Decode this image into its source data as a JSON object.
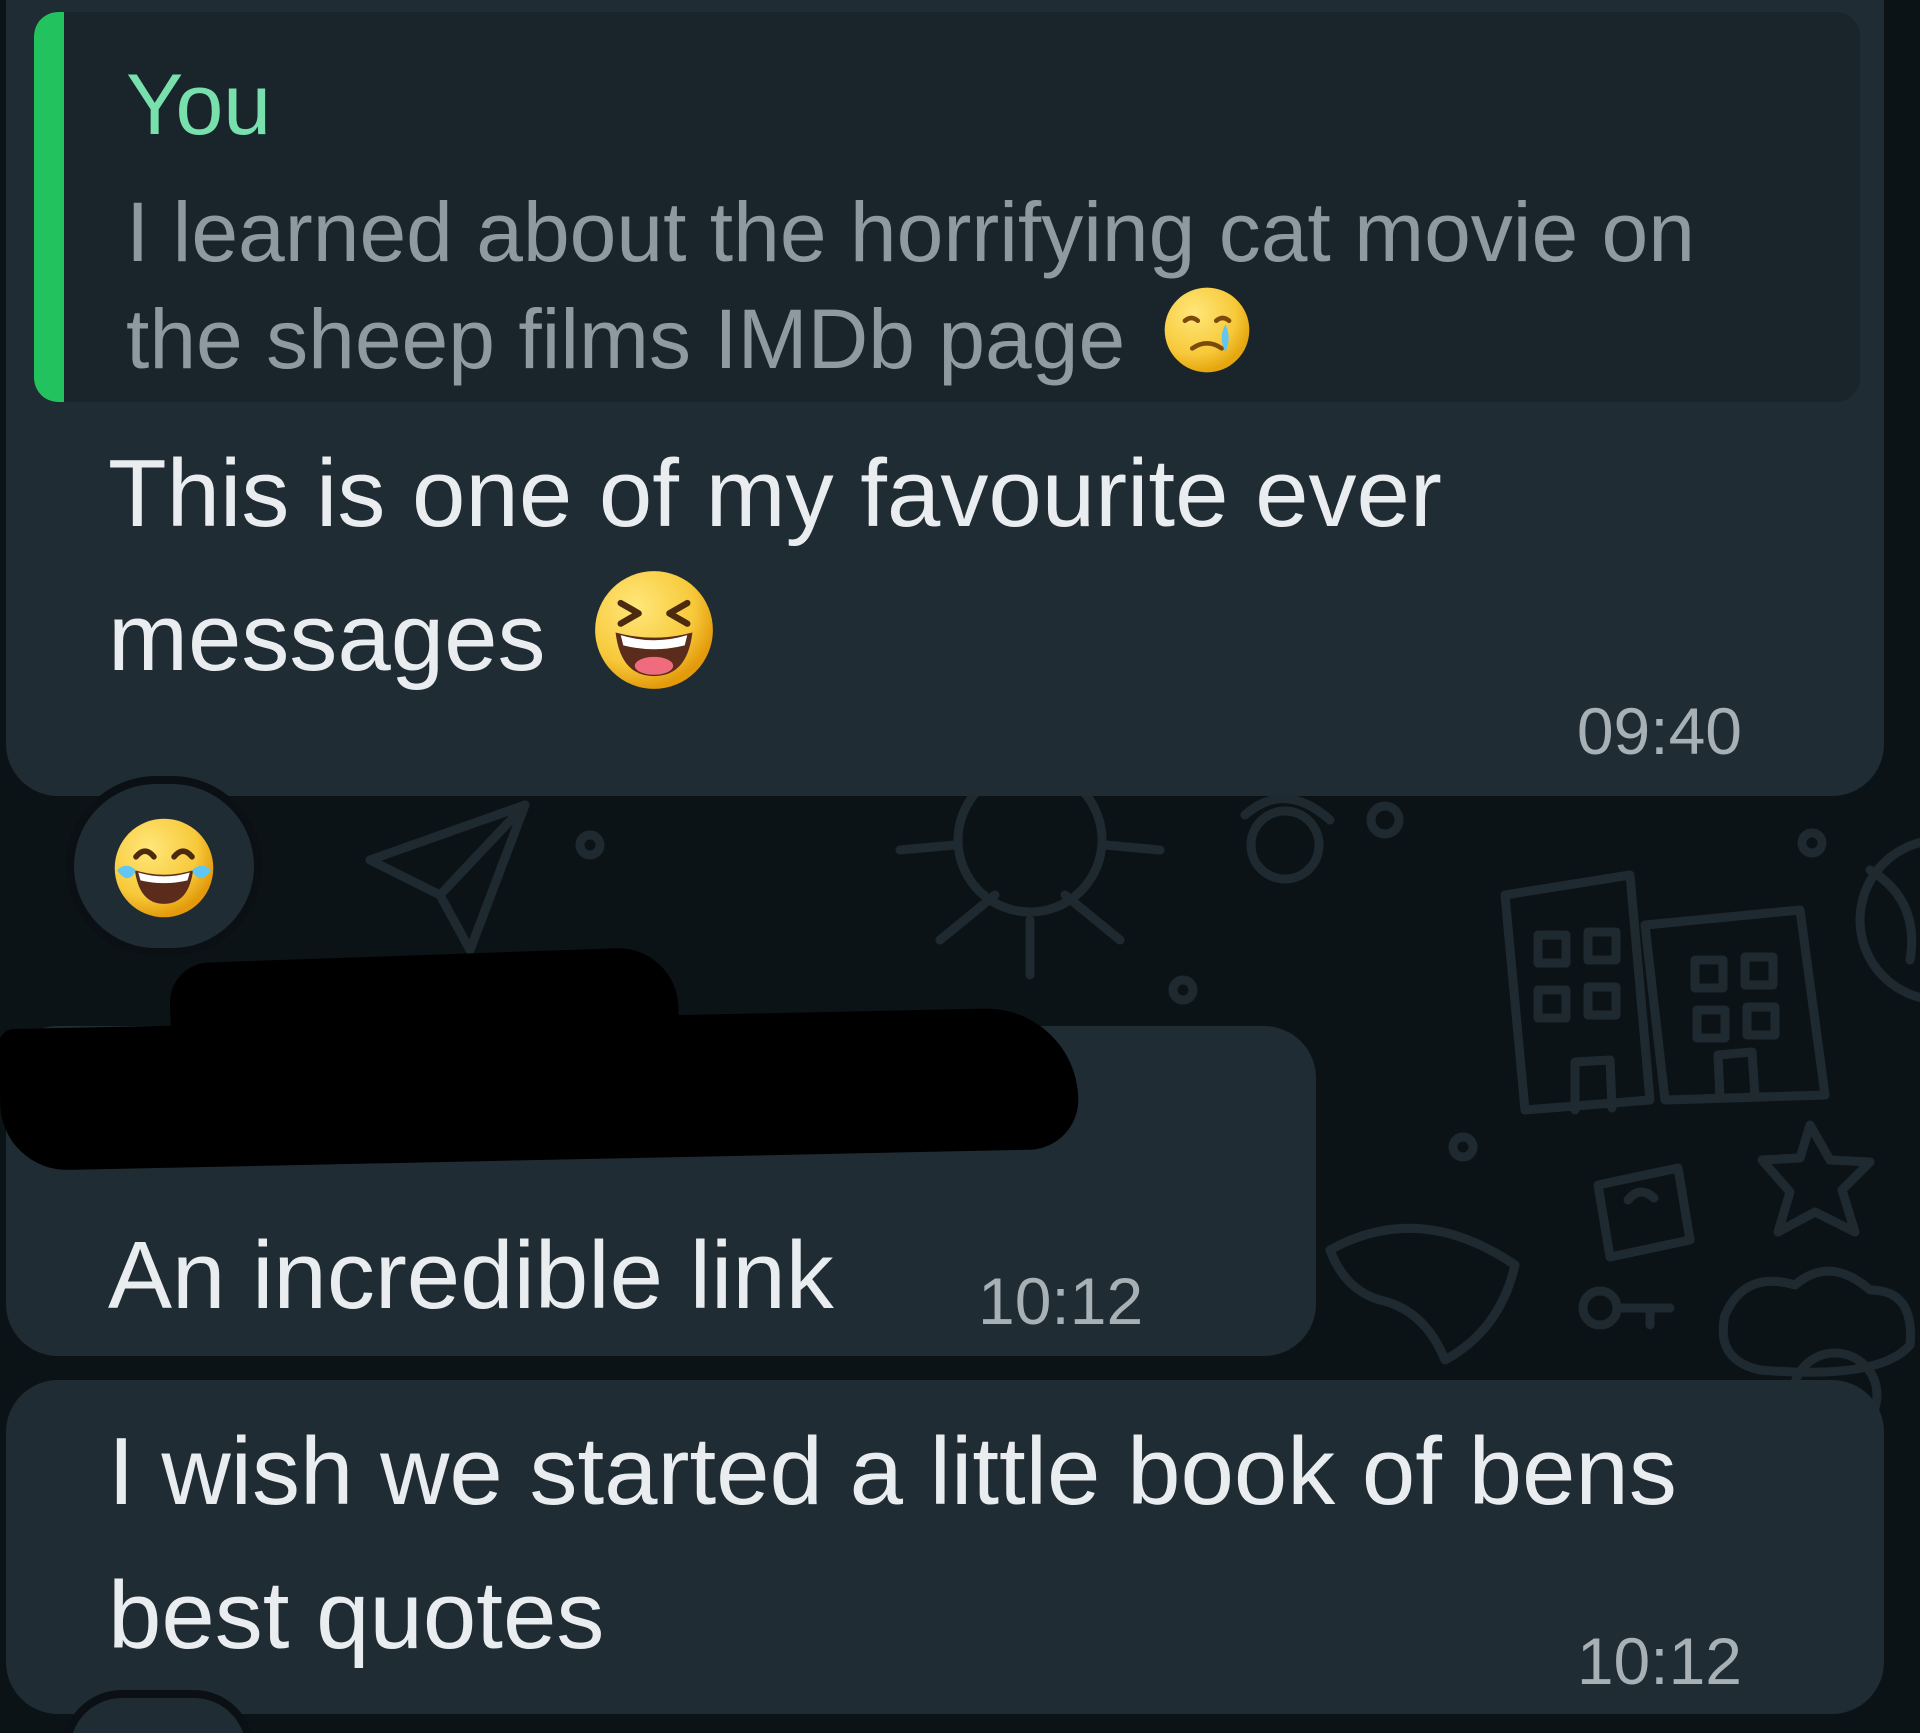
{
  "messages": [
    {
      "quote": {
        "author": "You",
        "text": "I learned about the horrifying cat movie on the sheep films IMDb page",
        "emoji": "crying-face-emoji"
      },
      "text": "This is one of my favourite ever messages",
      "emoji": "laughing-squinting-face-emoji",
      "time": "09:40",
      "reaction": "face-with-tears-of-joy-emoji"
    },
    {
      "sender": "",
      "text": "An incredible link",
      "time": "10:12"
    },
    {
      "text": "I wish we started a little book of bens best quotes",
      "time": "10:12"
    }
  ],
  "colors": {
    "background": "#0c1317",
    "bubble": "#202c33",
    "quote_background": "#1a242b",
    "quote_accent": "#22c35e",
    "quote_author": "#77e0ad",
    "message_text": "#e9edef",
    "time_text": "#a6b0b5"
  }
}
